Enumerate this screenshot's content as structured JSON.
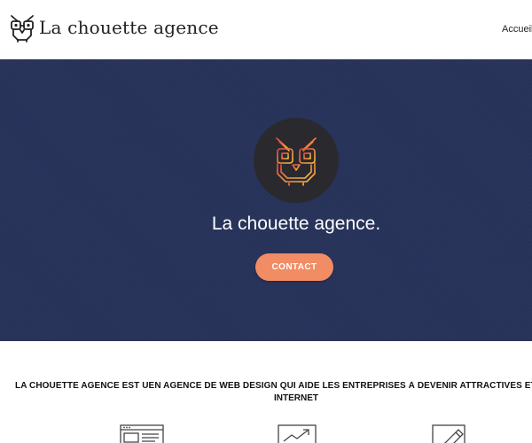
{
  "header": {
    "brand_name": "La chouette agence",
    "nav_item": "Accueil"
  },
  "hero": {
    "title": "La chouette agence.",
    "contact_label": "CONTACT",
    "colors": {
      "background": "#27335a",
      "button": "#f28c64",
      "owl_circle": "#2a2a2e"
    }
  },
  "intro": {
    "line1": "LA CHOUETTE AGENCE EST UEN AGENCE DE WEB DESIGN QUI AIDE LES ENTREPRISES À DEVENIR ATTRACTIVES ET VISIBLES SUR",
    "line2": "INTERNET"
  },
  "features": [
    {
      "icon": "browser-window-icon"
    },
    {
      "icon": "growth-chart-icon"
    },
    {
      "icon": "pencil-icon"
    }
  ]
}
